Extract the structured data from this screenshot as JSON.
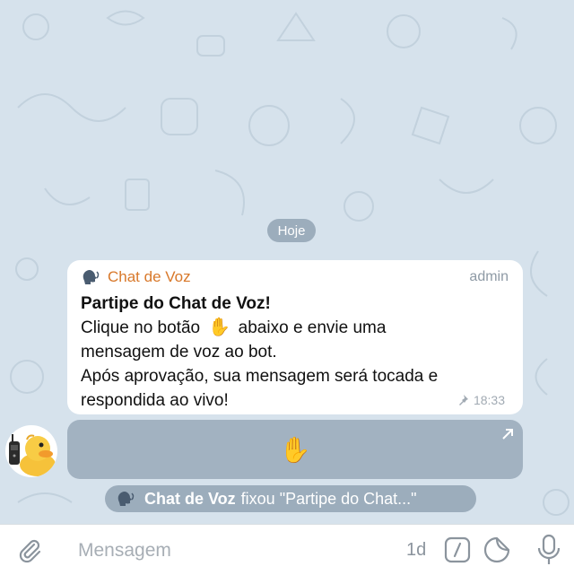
{
  "date_separator": "Hoje",
  "message": {
    "sender": "Chat de Voz",
    "role": "admin",
    "title": "Partipe do Chat de Voz!",
    "line1_before": "Clique no botão",
    "line1_emoji": "✋",
    "line1_after": "abaixo e envie uma",
    "line2": "mensagem de voz ao bot.",
    "line3": "Após aprovação, sua mensagem será tocada e",
    "line4": "respondida ao vivo!",
    "time": "18:33",
    "pinned": true
  },
  "inline_button": {
    "label": "✋"
  },
  "service_message": {
    "actor": "Chat de Voz",
    "action": "fixou \"Partipe do Chat...\""
  },
  "composer": {
    "placeholder": "Mensagem",
    "timer": "1d"
  },
  "colors": {
    "sender_name": "#d8782a",
    "bubble": "#ffffff",
    "pill": "#6e8296"
  }
}
